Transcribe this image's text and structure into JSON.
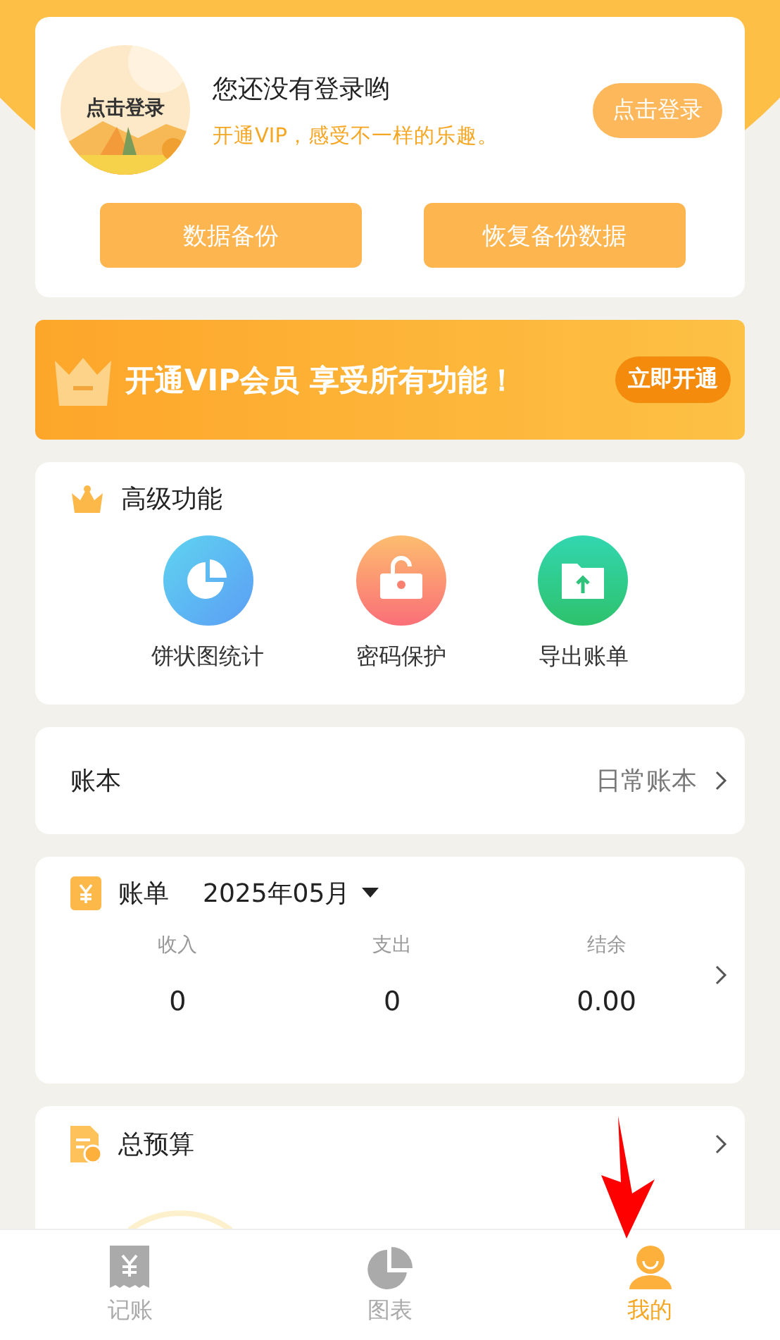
{
  "profile": {
    "avatar_label": "点击登录",
    "title": "您还没有登录哟",
    "subtitle": "开通VIP，感受不一样的乐趣。",
    "login_button": "点击登录",
    "actions": [
      "数据备份",
      "恢复备份数据"
    ]
  },
  "vip_banner": {
    "text": "开通VIP会员 享受所有功能！",
    "button": "立即开通"
  },
  "advanced": {
    "title": "高级功能",
    "items": [
      {
        "kind": "pie",
        "label": "饼状图统计"
      },
      {
        "kind": "lock",
        "label": "密码保护"
      },
      {
        "kind": "export",
        "label": "导出账单"
      }
    ]
  },
  "ledger": {
    "label": "账本",
    "value": "日常账本"
  },
  "bill": {
    "title": "账单",
    "month": "2025年05月",
    "stats": [
      {
        "label": "收入",
        "value": "0"
      },
      {
        "label": "支出",
        "value": "0"
      },
      {
        "label": "结余",
        "value": "0.00"
      }
    ]
  },
  "budget": {
    "title": "总预算"
  },
  "tabbar": [
    {
      "kind": "receipt",
      "label": "记账",
      "selected": false
    },
    {
      "kind": "chart",
      "label": "图表",
      "selected": false
    },
    {
      "kind": "person",
      "label": "我的",
      "selected": true
    }
  ]
}
